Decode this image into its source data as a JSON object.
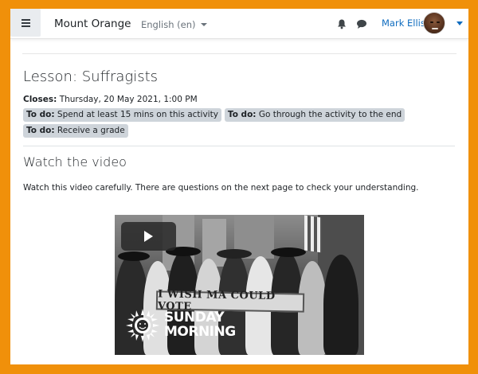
{
  "navbar": {
    "site_name": "Mount Orange",
    "language": "English (en)",
    "user_name": "Mark Ellis"
  },
  "lesson": {
    "title": "Lesson: Suffragists",
    "closes_label": "Closes:",
    "closes_value": "Thursday, 20 May 2021, 1:00 PM",
    "todos": [
      {
        "label": "To do:",
        "text": "Spend at least 15 mins on this activity"
      },
      {
        "label": "To do:",
        "text": "Go through the activity to the end"
      },
      {
        "label": "To do:",
        "text": "Receive a grade"
      }
    ]
  },
  "section": {
    "title": "Watch the video",
    "intro": "Watch this video carefully. There are questions on the next page to check your understanding."
  },
  "video": {
    "sign_text": "I WISH MA COULD VOTE",
    "show_line1": "SUNDAY",
    "show_line2": "MORNING"
  },
  "colors": {
    "frame_border": "#f0900a",
    "link_blue": "#0f6cbf",
    "badge_bg": "#ced4da"
  }
}
